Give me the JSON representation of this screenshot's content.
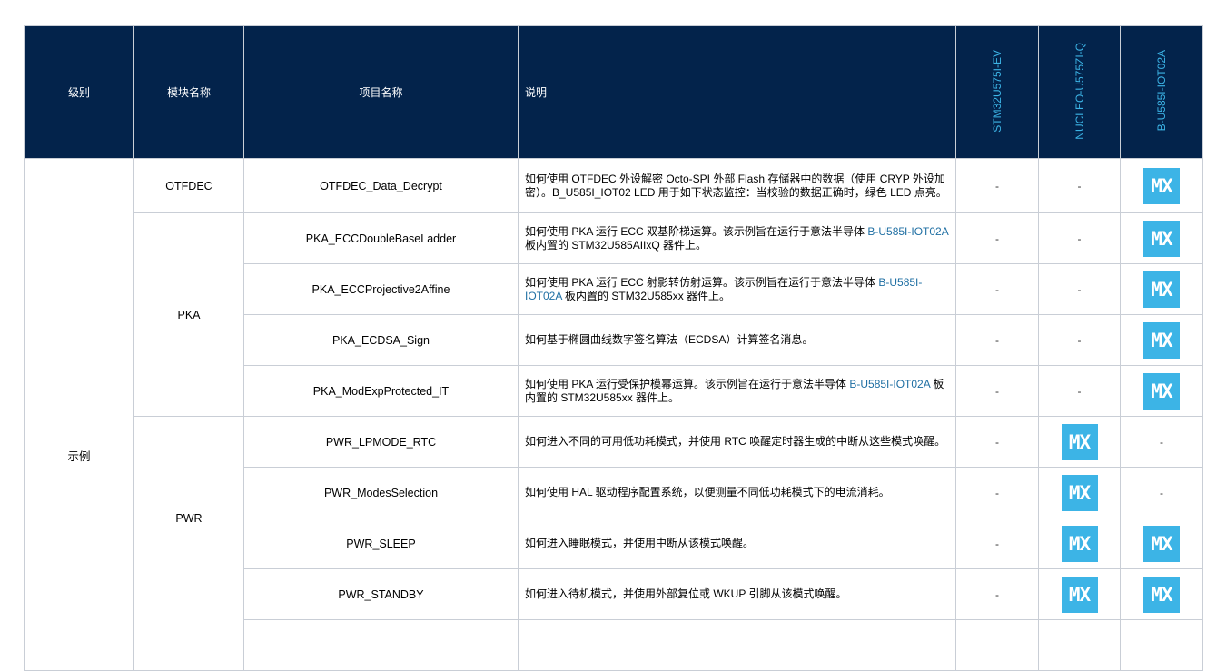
{
  "header": {
    "level": "级别",
    "module": "模块名称",
    "project": "项目名称",
    "description": "说明",
    "board1": "STM32U575I-EV",
    "board2": "NUCLEO-U575ZI-Q",
    "board3": "B-U585I-IOT02A"
  },
  "level_label": "示例",
  "dash": "-",
  "mx_label": "MX",
  "rows": [
    {
      "module": "OTFDEC",
      "project": "OTFDEC_Data_Decrypt",
      "desc": "如何使用 OTFDEC 外设解密 Octo-SPI 外部 Flash 存储器中的数据（使用 CRYP 外设加密）。B_U585I_IOT02 LED 用于如下状态监控：当校验的数据正确时，绿色 LED 点亮。"
    },
    {
      "module": "PKA",
      "project": "PKA_ECCDoubleBaseLadder",
      "desc_a": "如何使用 PKA 运行 ECC 双基阶梯运算。该示例旨在运行于意法半导体 ",
      "desc_link": "B-U585I-IOT02A",
      "desc_b": " 板内置的 STM32U585AIIxQ 器件上。"
    },
    {
      "project": "PKA_ECCProjective2Affine",
      "desc_a": "如何使用 PKA 运行 ECC 射影转仿射运算。该示例旨在运行于意法半导体 ",
      "desc_link": "B-U585I-IOT02A",
      "desc_b": " 板内置的 STM32U585xx 器件上。"
    },
    {
      "project": "PKA_ECDSA_Sign",
      "desc": "如何基于椭圆曲线数字签名算法（ECDSA）计算签名消息。"
    },
    {
      "project": "PKA_ModExpProtected_IT",
      "desc_a": "如何使用 PKA 运行受保护模幂运算。该示例旨在运行于意法半导体 ",
      "desc_link": "B-U585I-IOT02A",
      "desc_b": " 板内置的 STM32U585xx 器件上。"
    },
    {
      "module": "PWR",
      "project": "PWR_LPMODE_RTC",
      "desc": "如何进入不同的可用低功耗模式，并使用 RTC 唤醒定时器生成的中断从这些模式唤醒。"
    },
    {
      "project": "PWR_ModesSelection",
      "desc": "如何使用 HAL 驱动程序配置系统，以便测量不同低功耗模式下的电流消耗。"
    },
    {
      "project": "PWR_SLEEP",
      "desc": "如何进入睡眠模式，并使用中断从该模式唤醒。"
    },
    {
      "project": "PWR_STANDBY",
      "desc": "如何进入待机模式，并使用外部复位或 WKUP 引脚从该模式唤醒。"
    }
  ]
}
